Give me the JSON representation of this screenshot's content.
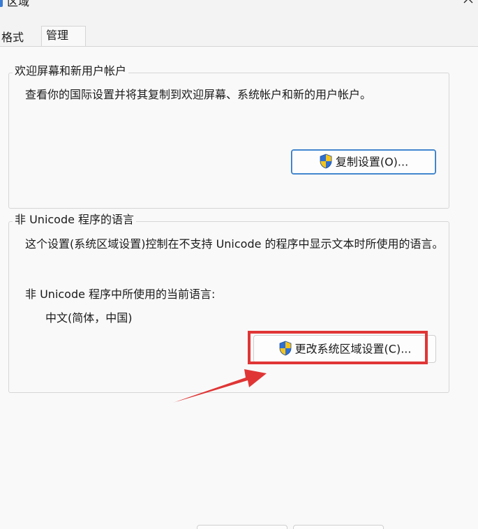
{
  "window": {
    "title": "区域"
  },
  "tabs": [
    {
      "label": "格式"
    },
    {
      "label": "管理"
    }
  ],
  "welcome_group": {
    "legend": "欢迎屏幕和新用户帐户",
    "description": "查看你的国际设置并将其复制到欢迎屏幕、系统帐户和新的用户帐户。",
    "button_label": "复制设置(O)..."
  },
  "unicode_group": {
    "legend": "非 Unicode 程序的语言",
    "description": "这个设置(系统区域设置)控制在不支持 Unicode 的程序中显示文本时所使用的语言。",
    "current_label": "非 Unicode 程序中所使用的当前语言:",
    "current_value": "中文(简体，中国)",
    "button_label": "更改系统区域设置(C)..."
  },
  "colors": {
    "annotation": "#e03535",
    "shield_blue": "#2f6fd1",
    "shield_yellow": "#f4c41c"
  },
  "icons": {
    "window": "globe-icon",
    "close": "close-icon",
    "uac": "uac-shield-icon"
  }
}
